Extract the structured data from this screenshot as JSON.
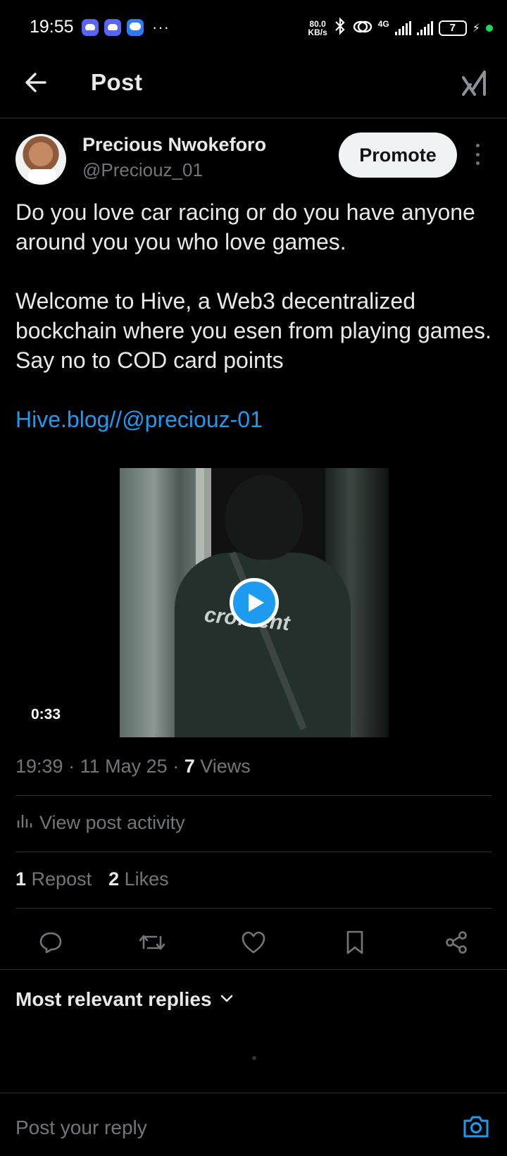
{
  "status_bar": {
    "time": "19:55",
    "more": "···",
    "net_speed_value": "80.0",
    "net_speed_unit": "KB/s",
    "network_type": "4G",
    "battery": "7"
  },
  "header": {
    "title": "Post"
  },
  "post": {
    "author_name": "Precious Nwokeforo",
    "author_handle": "@Preciouz_01",
    "promote_label": "Promote",
    "text_p1": "Do you love car racing or do you have anyone around you you who love games.",
    "text_p2": "Welcome to Hive, a Web3 decentralized bockchain where you esen from playing games. Say no to COD card points",
    "link": "Hive.blog//@preciouz-01",
    "video_duration": "0:33",
    "video_overlay_text": "cro…ent",
    "time": "19:39",
    "date": "11 May 25",
    "views_count": "7",
    "views_label": "Views",
    "view_activity_label": "View post activity",
    "reposts_count": "1",
    "reposts_label": "Repost",
    "likes_count": "2",
    "likes_label": "Likes"
  },
  "replies": {
    "sort_label": "Most relevant replies"
  },
  "reply_box": {
    "placeholder": "Post your reply"
  },
  "colors": {
    "background": "#000000",
    "accent": "#1d9bf0",
    "secondary_text": "#71767b",
    "primary_text": "#e7e9ea",
    "divider": "#2f3336"
  }
}
